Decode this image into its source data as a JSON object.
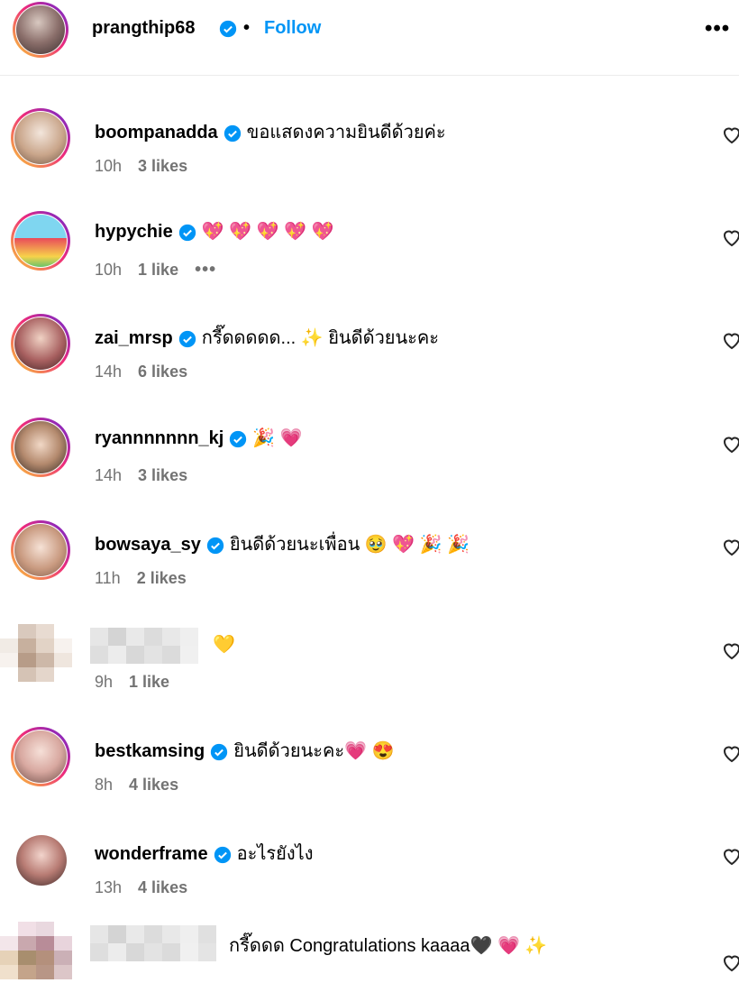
{
  "post": {
    "author": "prangthip68",
    "separator": "•",
    "follow_label": "Follow",
    "more_icon": "more-options-icon"
  },
  "comments": [
    {
      "username": "boompanadda",
      "verified": true,
      "text": "ขอแสดงความยินดีด้วยค่ะ",
      "time": "10h",
      "likes": "3 likes"
    },
    {
      "username": "hypychie",
      "verified": true,
      "text": "💖 💖 💖 💖 💖",
      "time": "10h",
      "likes": "1 like",
      "more": "•••"
    },
    {
      "username": "zai_mrsp",
      "verified": true,
      "text": "กรี๊ดดดดด... ✨ ยินดีด้วยนะคะ",
      "time": "14h",
      "likes": "6 likes"
    },
    {
      "username": "ryannnnnnn_kj",
      "verified": true,
      "text": "🎉 💗",
      "time": "14h",
      "likes": "3 likes"
    },
    {
      "username": "bowsaya_sy",
      "verified": true,
      "text": "ยินดีด้วยนะเพื่อน 🥹 💖 🎉 🎉",
      "time": "11h",
      "likes": "2 likes"
    },
    {
      "username": "",
      "verified": false,
      "text": "💛",
      "time": "9h",
      "likes": "1 like"
    },
    {
      "username": "bestkamsing",
      "verified": true,
      "text": "ยินดีด้วยนะคะ💗 😍",
      "time": "8h",
      "likes": "4 likes"
    },
    {
      "username": "wonderframe",
      "verified": true,
      "text": "อะไรยังไง",
      "time": "13h",
      "likes": "4 likes"
    },
    {
      "username": "",
      "verified": false,
      "text": "กรี๊ดดด Congratulations kaaaa🖤 💗 ✨",
      "time": "",
      "likes": ""
    }
  ],
  "colors": {
    "accent": "#0095f6",
    "muted": "#737373",
    "verified": "#0095f6"
  }
}
